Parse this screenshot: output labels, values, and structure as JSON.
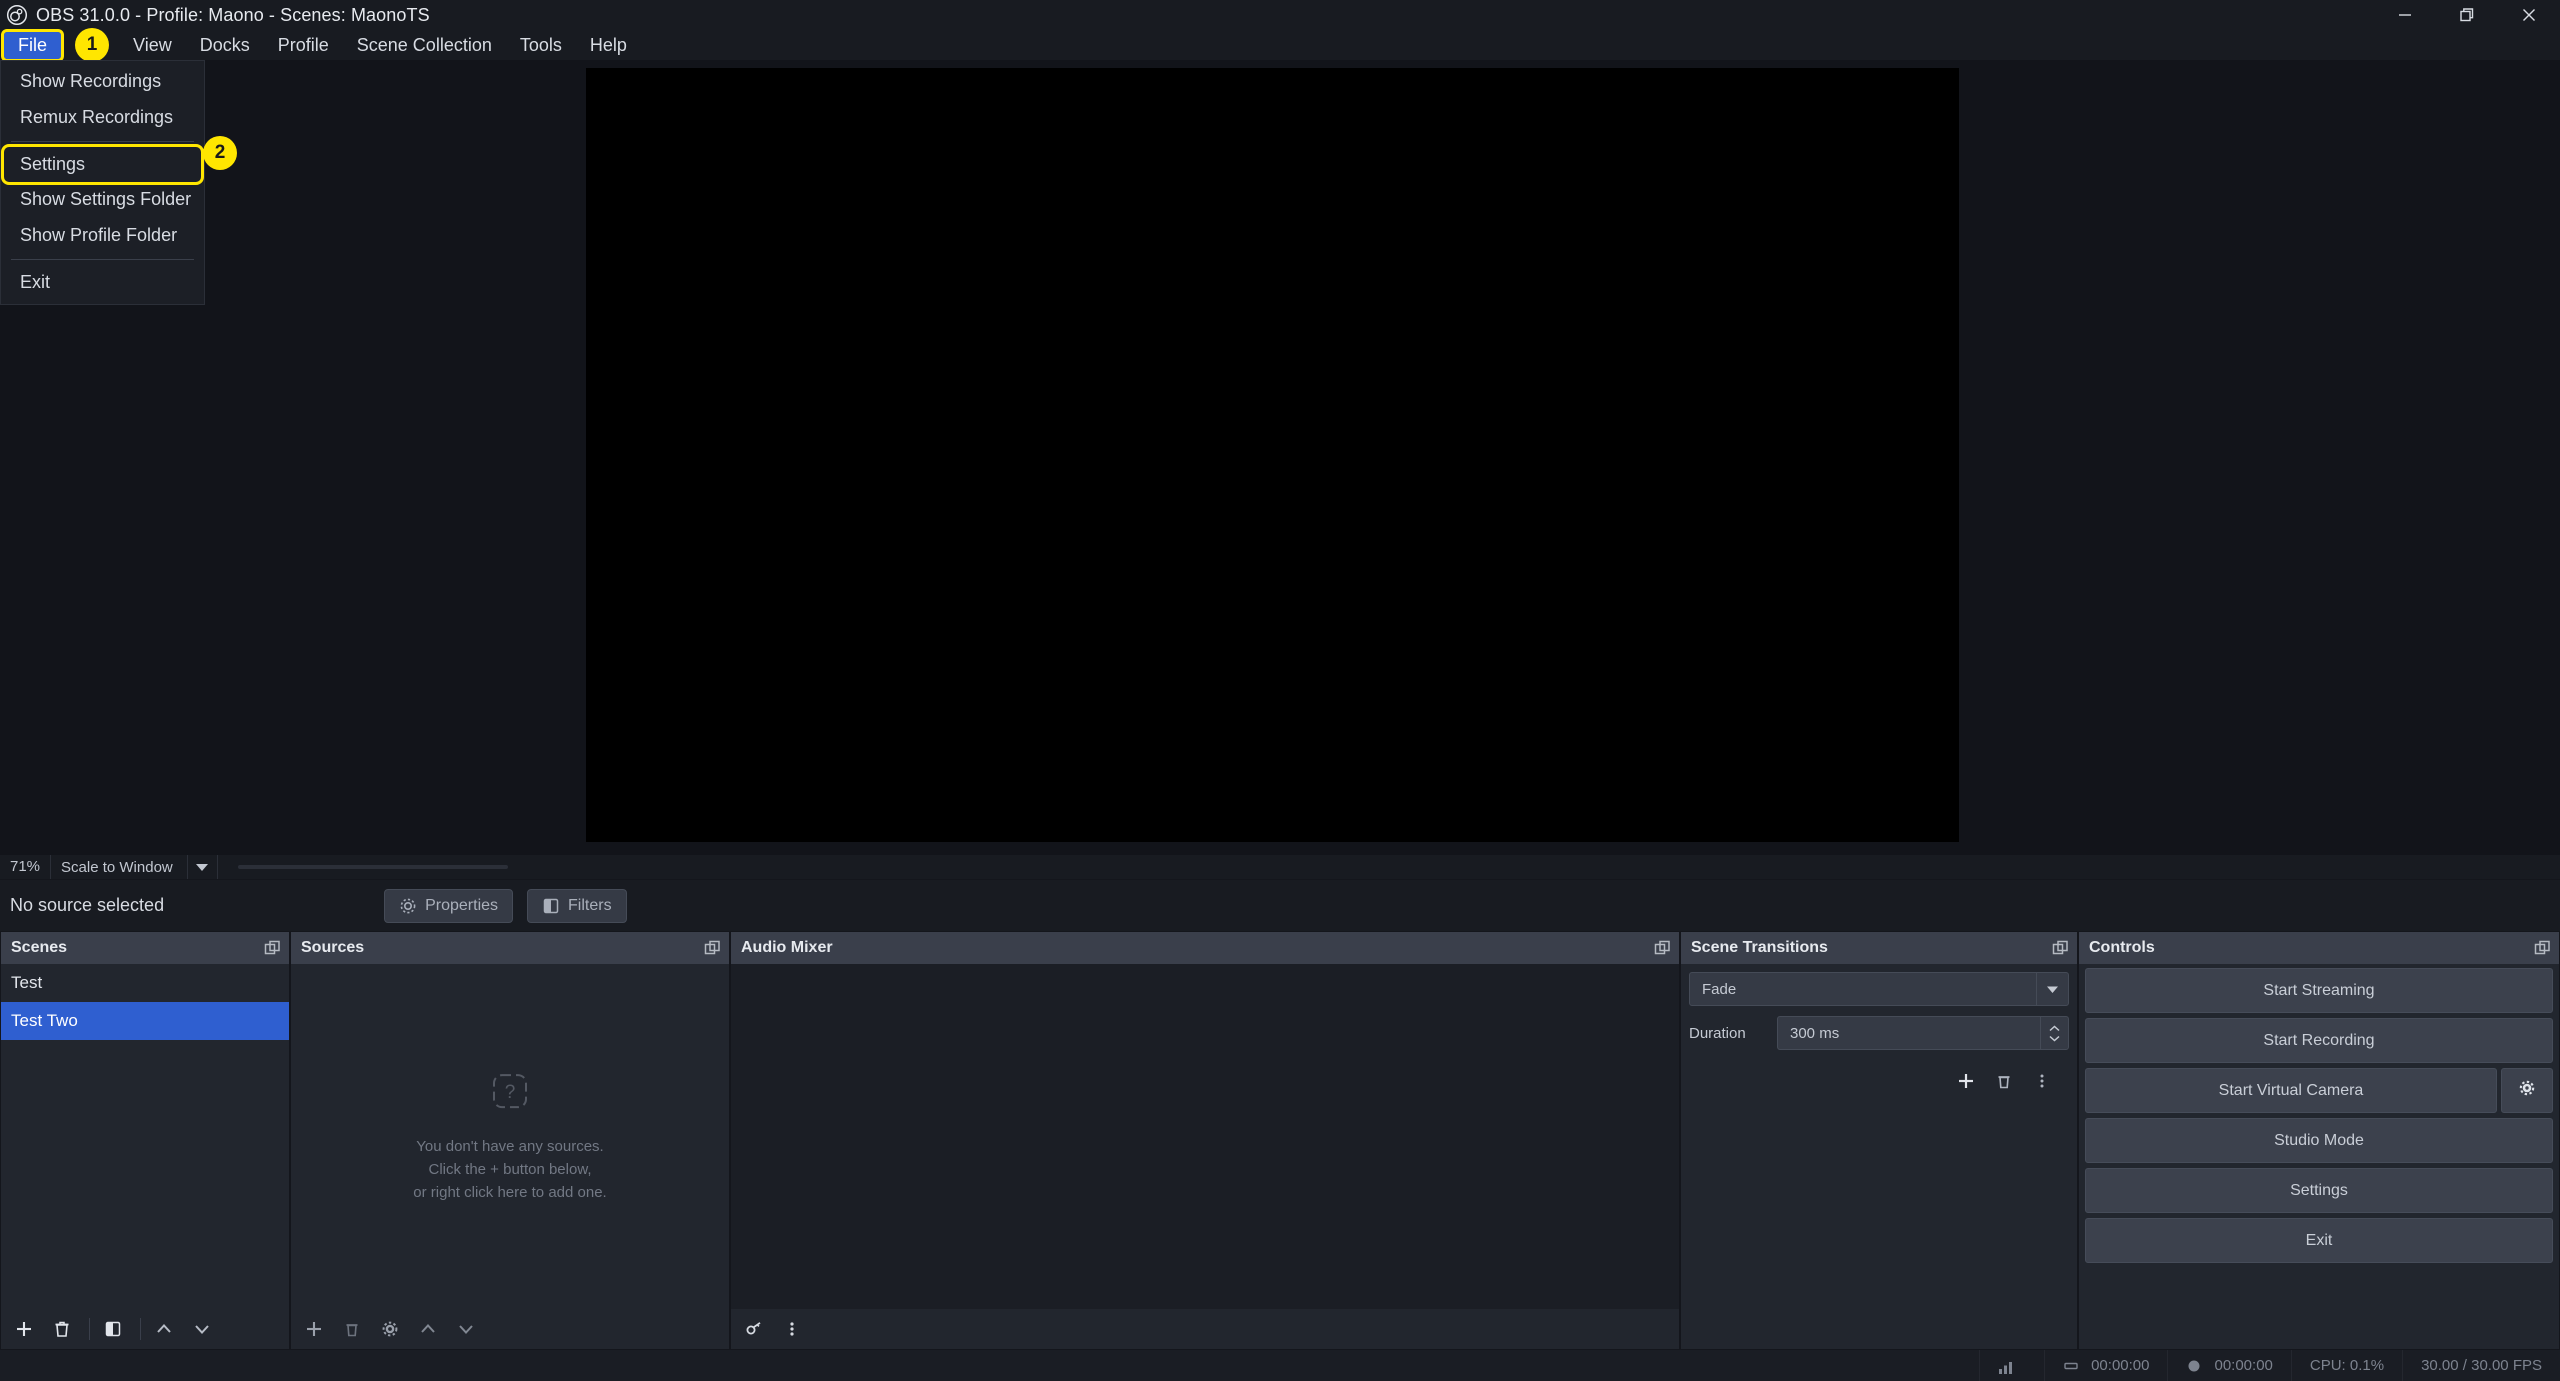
{
  "window": {
    "title": "OBS 31.0.0 - Profile: Maono - Scenes: MaonoTS",
    "logo_icon": "obs-logo-icon",
    "minimize_icon": "minimize-icon",
    "restore_icon": "restore-icon",
    "close_icon": "close-icon"
  },
  "menubar": {
    "items": [
      {
        "label": "File",
        "active": true
      },
      {
        "label": "View",
        "active": false
      },
      {
        "label": "Docks",
        "active": false
      },
      {
        "label": "Profile",
        "active": false
      },
      {
        "label": "Scene Collection",
        "active": false
      },
      {
        "label": "Tools",
        "active": false
      },
      {
        "label": "Help",
        "active": false
      }
    ],
    "badge_file": "1"
  },
  "file_menu": {
    "items": [
      {
        "label": "Show Recordings",
        "highlighted": false
      },
      {
        "label": "Remux Recordings",
        "highlighted": false
      },
      {
        "label": "Settings",
        "highlighted": true
      },
      {
        "label": "Show Settings Folder",
        "highlighted": false
      },
      {
        "label": "Show Profile Folder",
        "highlighted": false
      },
      {
        "label": "Exit",
        "highlighted": false
      }
    ],
    "badge_settings": "2"
  },
  "preview": {
    "scale_percent": "71%",
    "scale_mode": "Scale to Window",
    "no_source_text": "No source selected",
    "properties_label": "Properties",
    "filters_label": "Filters",
    "properties_icon": "gear-icon",
    "filters_icon": "filters-icon",
    "dropdown_icon": "chevron-down-icon"
  },
  "scenes": {
    "title": "Scenes",
    "float_icon": "undock-icon",
    "items": [
      {
        "label": "Test",
        "selected": false
      },
      {
        "label": "Test Two",
        "selected": true
      }
    ],
    "toolbar": [
      {
        "icon": "plus-icon",
        "name": "add-scene-button"
      },
      {
        "icon": "trash-icon",
        "name": "remove-scene-button"
      },
      {
        "icon": "filters-icon",
        "name": "scene-filters-button"
      },
      {
        "icon": "chevron-up-icon",
        "name": "move-scene-up-button"
      },
      {
        "icon": "chevron-down-icon",
        "name": "move-scene-down-button"
      }
    ]
  },
  "sources": {
    "title": "Sources",
    "float_icon": "undock-icon",
    "empty_icon": "question-box-icon",
    "empty_lines": [
      "You don't have any sources.",
      "Click the + button below,",
      "or right click here to add one."
    ],
    "toolbar": [
      {
        "icon": "plus-icon",
        "name": "add-source-button"
      },
      {
        "icon": "trash-icon",
        "name": "remove-source-button"
      },
      {
        "icon": "gear-icon",
        "name": "source-properties-button"
      },
      {
        "icon": "chevron-up-icon",
        "name": "move-source-up-button"
      },
      {
        "icon": "chevron-down-icon",
        "name": "move-source-down-button"
      }
    ]
  },
  "audio_mixer": {
    "title": "Audio Mixer",
    "float_icon": "undock-icon",
    "toolbar": [
      {
        "icon": "audio-settings-icon",
        "name": "audio-advanced-properties-button"
      },
      {
        "icon": "vertical-dots-icon",
        "name": "audio-menu-button"
      }
    ]
  },
  "scene_transitions": {
    "title": "Scene Transitions",
    "float_icon": "undock-icon",
    "selected_transition": "Fade",
    "duration_label": "Duration",
    "duration_value": "300 ms",
    "dropdown_icon": "chevron-down-icon",
    "toolbar": [
      {
        "icon": "plus-icon",
        "name": "add-transition-button"
      },
      {
        "icon": "trash-icon",
        "name": "remove-transition-button"
      },
      {
        "icon": "vertical-dots-icon",
        "name": "transition-menu-button"
      }
    ]
  },
  "controls": {
    "title": "Controls",
    "float_icon": "undock-icon",
    "buttons": [
      {
        "label": "Start Streaming",
        "name": "start-streaming-button"
      },
      {
        "label": "Start Recording",
        "name": "start-recording-button"
      },
      {
        "label": "Start Virtual Camera",
        "name": "start-virtual-camera-button"
      },
      {
        "label": "Studio Mode",
        "name": "studio-mode-button"
      },
      {
        "label": "Settings",
        "name": "settings-button"
      },
      {
        "label": "Exit",
        "name": "exit-button"
      }
    ],
    "virtual_camera_config_icon": "gear-icon"
  },
  "statusbar": {
    "signal_icon": "signal-bars-icon",
    "stream_icon": "stream-icon",
    "stream_time": "00:00:00",
    "record_icon": "record-icon",
    "record_time": "00:00:00",
    "cpu": "CPU: 0.1%",
    "fps": "30.00 / 30.00 FPS"
  },
  "colors": {
    "accent_blue": "#2f5fd0",
    "highlight_yellow": "#ffe600",
    "window_bg": "#12141a",
    "panel_bg": "#22262e",
    "header_bg": "#3a3f4b"
  }
}
